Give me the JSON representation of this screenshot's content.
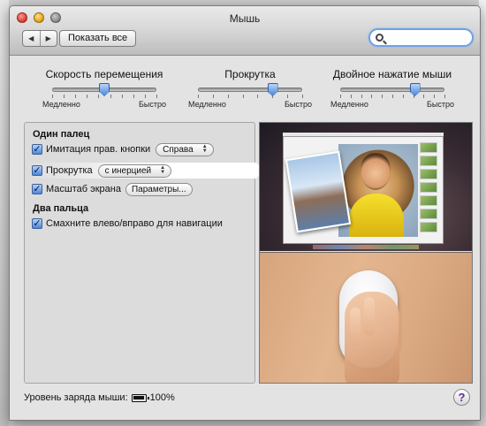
{
  "window": {
    "title": "Мышь"
  },
  "toolbar": {
    "back_glyph": "◀",
    "forward_glyph": "▶",
    "show_all_label": "Показать все",
    "search_value": ""
  },
  "sliders": [
    {
      "title": "Скорость перемещения",
      "min_label": "Медленно",
      "max_label": "Быстро",
      "value_fraction": 0.5,
      "tick_count": 10
    },
    {
      "title": "Прокрутка",
      "min_label": "Медленно",
      "max_label": "Быстро",
      "value_fraction": 0.72,
      "tick_count": 8
    },
    {
      "title": "Двойное нажатие мыши",
      "min_label": "Медленно",
      "max_label": "Быстро",
      "value_fraction": 0.72,
      "tick_count": 11
    }
  ],
  "one_finger": {
    "title": "Один палец",
    "secondary_click": {
      "label": "Имитация прав. кнопки",
      "checked": true,
      "value": "Справа"
    },
    "scrolling": {
      "label": "Прокрутка",
      "checked": true,
      "value": "с инерцией"
    },
    "zoom": {
      "label": "Масштаб экрана",
      "checked": true,
      "button_label": "Параметры..."
    }
  },
  "two_fingers": {
    "title": "Два пальца",
    "swipe": {
      "label": "Смахните влево/вправо для навигации",
      "checked": true
    }
  },
  "status": {
    "battery_label": "Уровень заряда мыши:",
    "battery_percent": "100%"
  },
  "help": {
    "label": "?"
  },
  "icons": {
    "checkmark": "✓",
    "popup_up": "▲",
    "popup_down": "▼"
  },
  "colors": {
    "accent": "#4c86d8",
    "help_accent": "#5b2f9a"
  }
}
